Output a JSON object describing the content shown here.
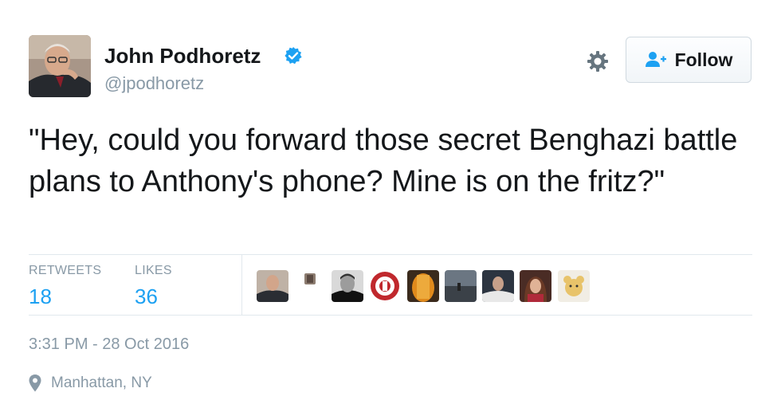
{
  "author": {
    "name": "John Podhoretz",
    "handle": "@jpodhoretz",
    "verified": true
  },
  "actions": {
    "follow_label": "Follow"
  },
  "tweet": {
    "text": "\"Hey, could you forward those secret Benghazi battle plans to Anthony's phone? Mine is on the fritz?\"",
    "timestamp": "3:31 PM - 28 Oct 2016",
    "location": "Manhattan, NY"
  },
  "stats": {
    "retweets_label": "RETWEETS",
    "retweets_count": "18",
    "likes_label": "LIKES",
    "likes_count": "36"
  },
  "icons": {
    "verified": "verified-badge-icon",
    "settings": "gear-icon",
    "follow": "add-user-icon",
    "location": "map-pin-icon"
  },
  "colors": {
    "accent": "#1da1f2",
    "muted": "#8899a6",
    "text": "#14171a",
    "divider": "#e1e8ed"
  }
}
